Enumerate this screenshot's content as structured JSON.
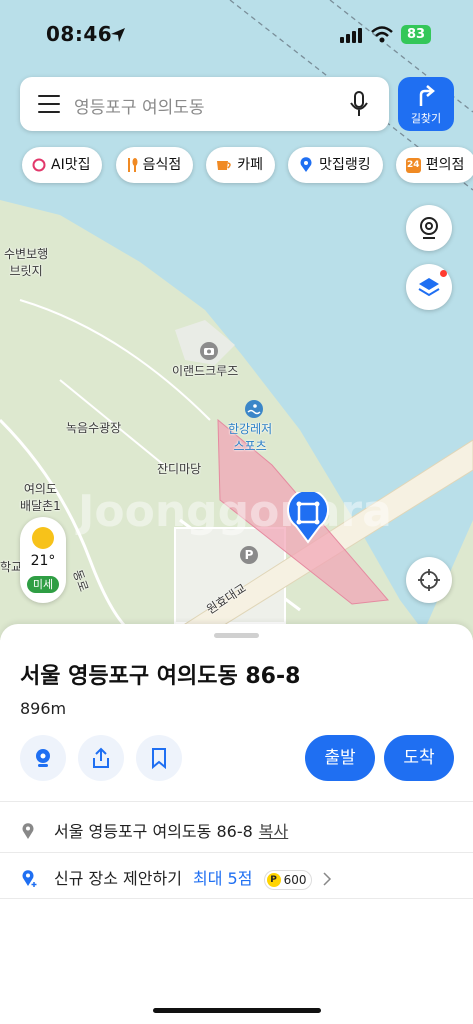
{
  "status_bar": {
    "time": "08:46",
    "battery": "83"
  },
  "search": {
    "placeholder": "영등포구 여의도동"
  },
  "route_button": {
    "label": "길찾기"
  },
  "chips": [
    {
      "label": "AI맛집",
      "icon": "ai-ring-icon"
    },
    {
      "label": "음식점",
      "icon": "utensils-icon"
    },
    {
      "label": "카페",
      "icon": "coffee-cup-icon"
    },
    {
      "label": "맛집랭킹",
      "icon": "ranking-pin-icon"
    },
    {
      "label": "편의점",
      "icon": "convenience-24-icon",
      "badge": "24"
    }
  ],
  "map": {
    "labels": {
      "bridge": "수변보행\n브릿지",
      "island_cruise": "이랜드크루즈",
      "green_plaza": "녹음수광장",
      "lawn": "잔디마당",
      "village": "여의도\n배달촌1",
      "han_leisure": "한강레저\n스포츠",
      "wonhyo": "원효대교",
      "school": "학교",
      "road": "동로"
    },
    "watermark": "Joonggonara",
    "colors": {
      "water": "#b9dfe9",
      "land": "#dde8cf",
      "highlight": "#f2a3b5"
    }
  },
  "weather": {
    "temperature": "21°",
    "dust": "미세"
  },
  "sheet": {
    "title": "서울 영등포구 여의도동 86-8",
    "distance": "896m",
    "depart_label": "출발",
    "arrive_label": "도착",
    "address": "서울 영등포구 여의도동 86-8",
    "copy_label": "복사",
    "suggest_label": "신규 장소 제안하기",
    "suggest_reward": "최대 5점",
    "points_badge": "P",
    "points": "600"
  }
}
